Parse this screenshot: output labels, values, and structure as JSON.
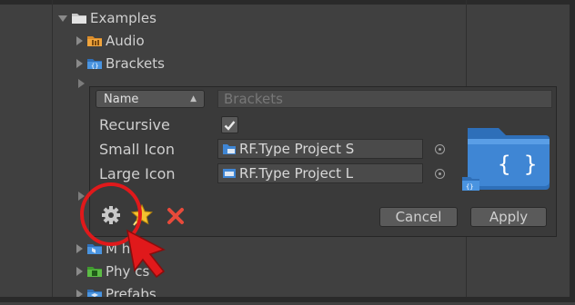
{
  "tree": {
    "root_label": "Examples",
    "items": [
      {
        "label": "Audio"
      },
      {
        "label": "Brackets"
      }
    ],
    "bottom_items": [
      {
        "label": "M  hes"
      },
      {
        "label": "Phy  cs"
      },
      {
        "label": "Prefabs"
      }
    ]
  },
  "popup": {
    "mode_dropdown": {
      "selected": "Name"
    },
    "name_field": {
      "value": "",
      "placeholder": "Brackets"
    },
    "recursive_label": "Recursive",
    "recursive_checked": true,
    "small_icon_label": "Small Icon",
    "small_icon_value": "RF.Type Project S",
    "large_icon_label": "Large Icon",
    "large_icon_value": "RF.Type Project L",
    "preview_symbol": "{ }",
    "buttons": {
      "cancel": "Cancel",
      "apply": "Apply"
    },
    "tools": [
      "gear-icon",
      "star-icon",
      "delete-icon"
    ]
  },
  "colors": {
    "folder_blue": "#3f86d4",
    "highlight_red": "#e0191b",
    "delete_red": "#e84a3a",
    "star_yellow": "#f2c230"
  }
}
